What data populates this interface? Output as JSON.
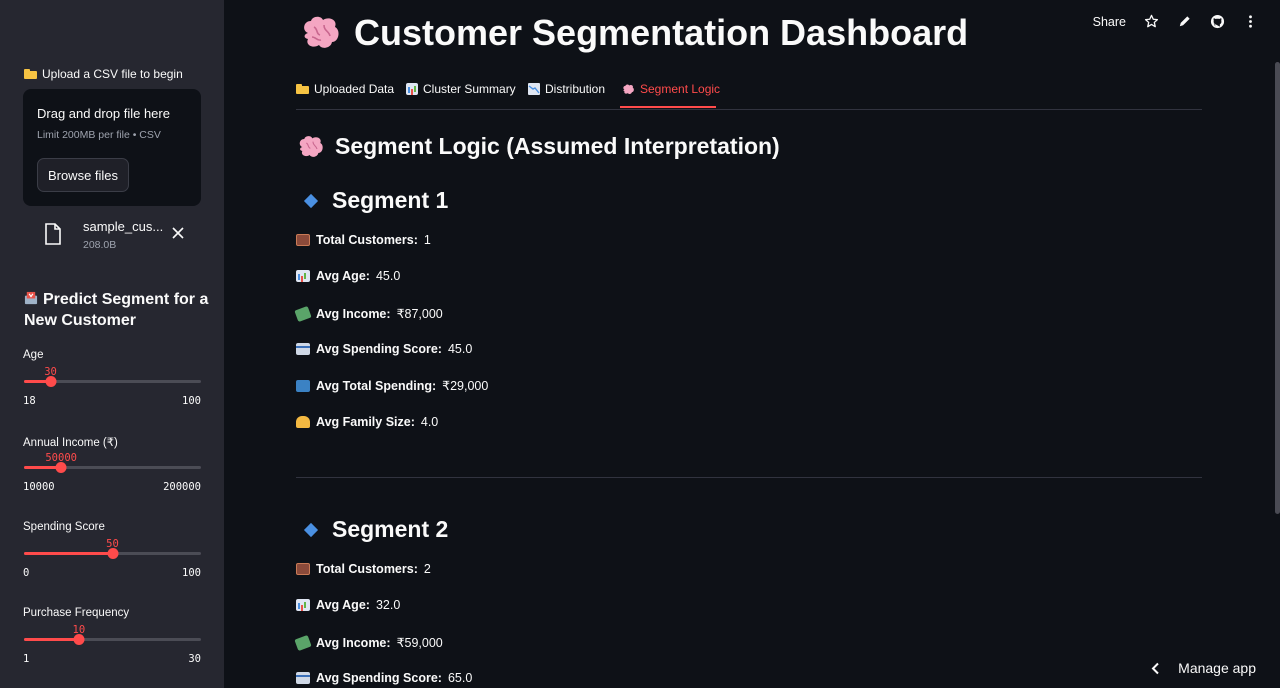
{
  "sidebar": {
    "upload_label": "Upload a CSV file to begin",
    "dropzone_title": "Drag and drop file here",
    "dropzone_limit": "Limit 200MB per file • CSV",
    "browse_label": "Browse files",
    "file": {
      "name": "sample_cus...",
      "size": "208.0B"
    },
    "predict_heading": "Predict Segment for a New Customer",
    "sliders": [
      {
        "label": "Age",
        "value": "30",
        "min": "18",
        "max": "100",
        "fraction": 0.15
      },
      {
        "label": "Annual Income (₹)",
        "value": "50000",
        "min": "10000",
        "max": "200000",
        "fraction": 0.21
      },
      {
        "label": "Spending Score",
        "value": "50",
        "min": "0",
        "max": "100",
        "fraction": 0.5
      },
      {
        "label": "Purchase Frequency",
        "value": "10",
        "min": "1",
        "max": "30",
        "fraction": 0.31
      }
    ]
  },
  "header": {
    "title": "Customer Segmentation Dashboard",
    "share_label": "Share"
  },
  "tabs": [
    {
      "label": "Uploaded Data",
      "icon": "folder-icon",
      "active": false
    },
    {
      "label": "Cluster Summary",
      "icon": "bar-chart-icon",
      "active": false
    },
    {
      "label": "Distribution",
      "icon": "chart-decreasing-icon",
      "active": false
    },
    {
      "label": "Segment Logic",
      "icon": "brain-icon",
      "active": true
    }
  ],
  "main": {
    "section_heading": "Segment Logic (Assumed Interpretation)",
    "segments": [
      {
        "heading": "Segment 1",
        "stats": [
          {
            "label": "Total Customers:",
            "value": "1",
            "icon": "abacus-icon"
          },
          {
            "label": "Avg Age:",
            "value": "45.0",
            "icon": "bar-chart-icon"
          },
          {
            "label": "Avg Income:",
            "value": "₹87,000",
            "icon": "money-wings-icon"
          },
          {
            "label": "Avg Spending Score:",
            "value": "45.0",
            "icon": "credit-card-icon"
          },
          {
            "label": "Avg Total Spending:",
            "value": "₹29,000",
            "icon": "shopping-bags-icon"
          },
          {
            "label": "Avg Family Size:",
            "value": "4.0",
            "icon": "family-icon"
          }
        ]
      },
      {
        "heading": "Segment 2",
        "stats": [
          {
            "label": "Total Customers:",
            "value": "2",
            "icon": "abacus-icon"
          },
          {
            "label": "Avg Age:",
            "value": "32.0",
            "icon": "bar-chart-icon"
          },
          {
            "label": "Avg Income:",
            "value": "₹59,000",
            "icon": "money-wings-icon"
          },
          {
            "label": "Avg Spending Score:",
            "value": "65.0",
            "icon": "credit-card-icon"
          }
        ]
      }
    ]
  },
  "footer": {
    "manage_app": "Manage app"
  },
  "colors": {
    "accent": "#ff4b4b",
    "background": "#0e1117",
    "sidebar": "#262730",
    "diamond": "#4a90e2"
  }
}
